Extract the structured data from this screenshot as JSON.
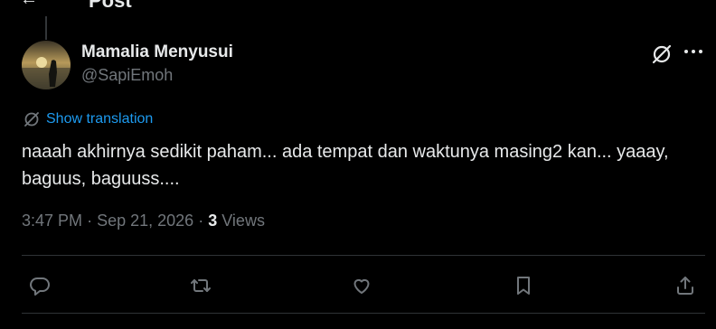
{
  "header": {
    "back_icon": "arrow-left-icon",
    "title": "Post"
  },
  "author": {
    "name": "Mamalia Menyusui",
    "handle": "@SapiEmoh",
    "avatar": "sunset-silhouette-avatar"
  },
  "translation": {
    "label": "Show translation",
    "icon": "globe-translate-icon"
  },
  "post": {
    "text": "naaah akhirnya sedikit paham... ada tempat dan waktunya masing2 kan... yaaay, baguus, baguuss...."
  },
  "meta": {
    "time": "3:47 PM",
    "date": "Sep 21, 2026",
    "sep": "·",
    "views_count": "3",
    "views_label": "Views"
  },
  "actions": [
    "reply-icon",
    "repost-icon",
    "like-icon",
    "bookmark-icon",
    "share-icon"
  ],
  "colors": {
    "background": "#000000",
    "text": "#e7e9ea",
    "muted": "#71767b",
    "link": "#1d9bf0",
    "border": "#2f3336"
  }
}
